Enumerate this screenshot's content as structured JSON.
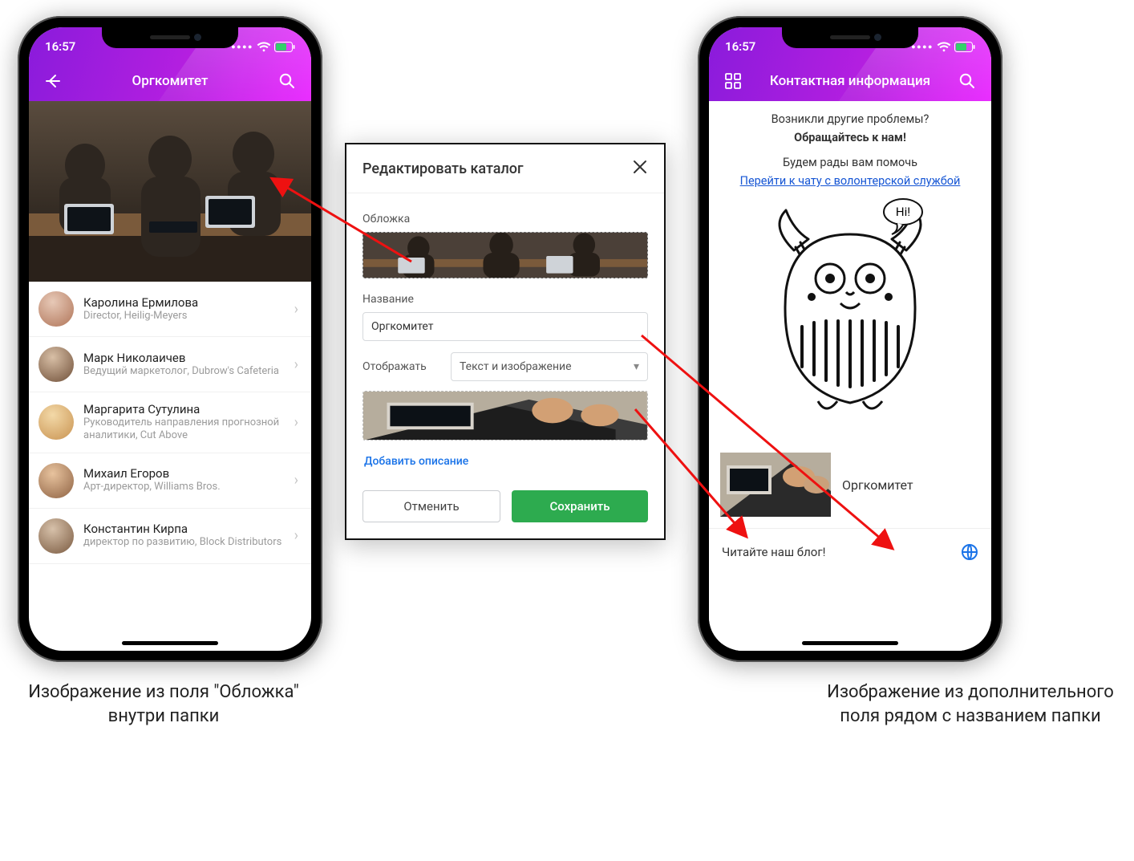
{
  "status": {
    "time": "16:57"
  },
  "header": {
    "left_title": "Оргкомитет",
    "right_title": "Контактная информация"
  },
  "contacts": [
    {
      "name": "Каролина Ермилова",
      "sub": "Director, Heilig-Meyers"
    },
    {
      "name": "Марк Николаичев",
      "sub": "Ведущий маркетолог, Dubrow's Cafeteria"
    },
    {
      "name": "Маргарита Сутулина",
      "sub": "Руководитель направления прогнозной аналитики, Cut Above"
    },
    {
      "name": "Михаил Егоров",
      "sub": "Арт-директор, Williams Bros."
    },
    {
      "name": "Константин Кирпа",
      "sub": "директор по развитию, Block Distributors"
    }
  ],
  "dialog": {
    "title": "Редактировать каталог",
    "cover_label": "Обложка",
    "name_label": "Название",
    "name_value": "Оргкомитет",
    "display_label": "Отображать",
    "display_value": "Текст и изображение",
    "add_desc": "Добавить описание",
    "cancel": "Отменить",
    "save": "Сохранить"
  },
  "info": {
    "line1": "Возникли другие проблемы?",
    "line2": "Обращайтесь к нам!",
    "line3": "Будем рады вам помочь",
    "link": "Перейти к чату с волонтерской службой",
    "bubble": "Hi!",
    "org_label": "Оргкомитет",
    "blog": "Читайте наш блог!"
  },
  "captions": {
    "left": "Изображение из поля \"Обложка\" внутри папки",
    "right": "Изображение из дополнительного поля рядом с названием папки"
  }
}
